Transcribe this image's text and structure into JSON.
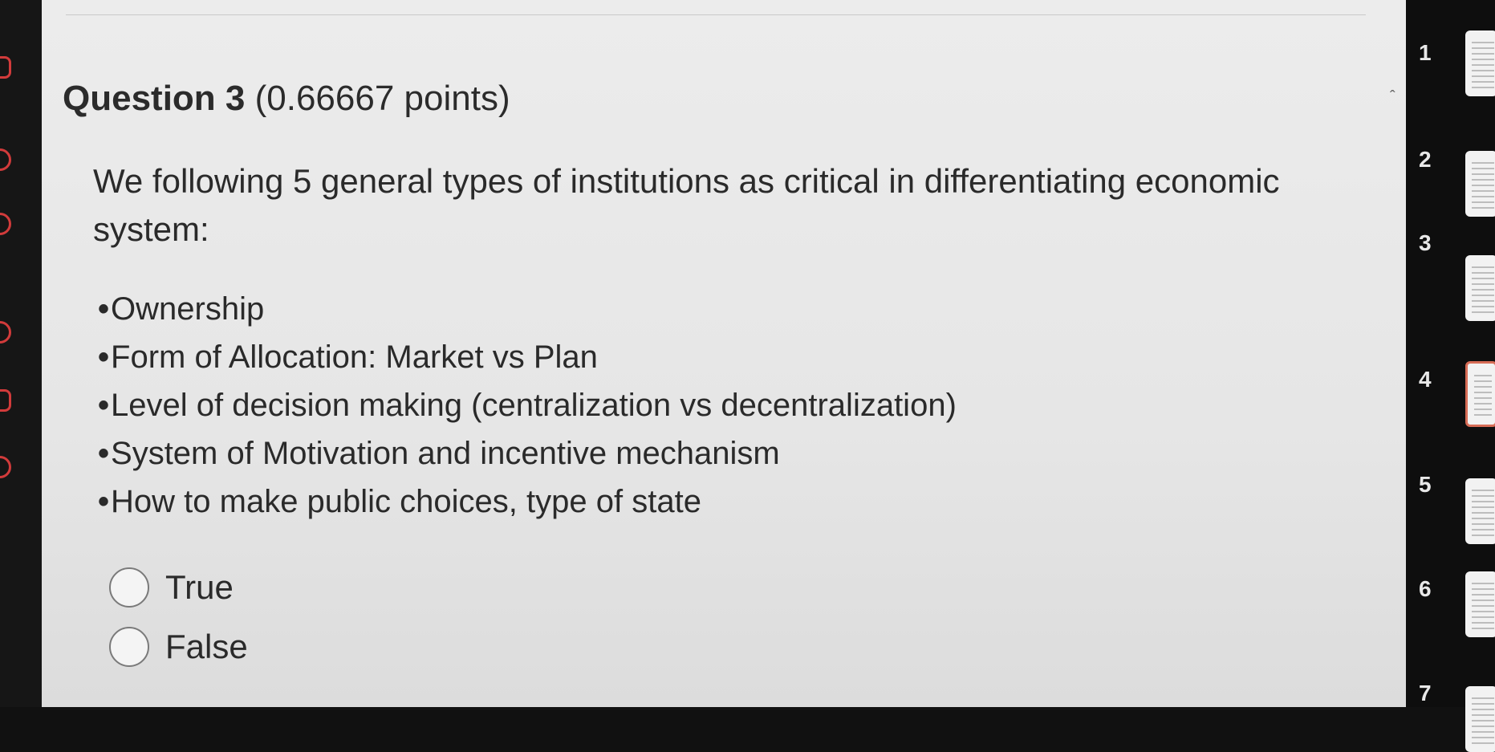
{
  "question": {
    "label": "Question 3",
    "points": "(0.66667 points)",
    "text": "We following 5 general types of institutions as critical in differentiating economic system:",
    "bullets": [
      "Ownership",
      "Form of Allocation: Market vs Plan",
      "Level of decision making (centralization vs decentralization)",
      "System of Motivation and incentive mechanism",
      "How to make public choices, type of state"
    ],
    "bullet_symbol": "•",
    "options": [
      "True",
      "False"
    ]
  },
  "nav": {
    "numbers": [
      "1",
      "2",
      "3",
      "4",
      "5",
      "6",
      "7"
    ],
    "active_index": 3
  },
  "colors": {
    "panel_bg": "#e6e6e6",
    "text": "#2a2a2a",
    "active_thumb_border": "#d76c56",
    "left_icon": "#d23b3b"
  },
  "icons": [
    "caret-up-icon"
  ]
}
